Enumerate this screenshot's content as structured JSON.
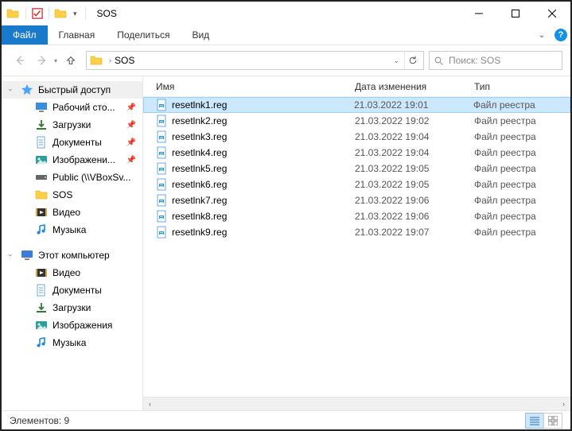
{
  "titlebar": {
    "title": "SOS"
  },
  "ribbon": {
    "file": "Файл",
    "home": "Главная",
    "share": "Поделиться",
    "view": "Вид"
  },
  "address": {
    "crumb": "SOS"
  },
  "search": {
    "placeholder": "Поиск: SOS"
  },
  "sidebar": {
    "quick_access": "Быстрый доступ",
    "items": [
      {
        "label": "Рабочий сто...",
        "icon": "desktop",
        "pinned": true
      },
      {
        "label": "Загрузки",
        "icon": "downloads",
        "pinned": true
      },
      {
        "label": "Документы",
        "icon": "documents",
        "pinned": true
      },
      {
        "label": "Изображени...",
        "icon": "pictures",
        "pinned": true
      },
      {
        "label": "Public (\\\\VBoxSv...",
        "icon": "drive",
        "pinned": false
      },
      {
        "label": "SOS",
        "icon": "folder",
        "pinned": false
      },
      {
        "label": "Видео",
        "icon": "videos",
        "pinned": false
      },
      {
        "label": "Музыка",
        "icon": "music",
        "pinned": false
      }
    ],
    "this_pc": "Этот компьютер",
    "pc_items": [
      {
        "label": "Видео",
        "icon": "videos"
      },
      {
        "label": "Документы",
        "icon": "documents"
      },
      {
        "label": "Загрузки",
        "icon": "downloads"
      },
      {
        "label": "Изображения",
        "icon": "pictures"
      },
      {
        "label": "Музыка",
        "icon": "music"
      }
    ]
  },
  "columns": {
    "name": "Имя",
    "date": "Дата изменения",
    "type": "Тип"
  },
  "files": [
    {
      "name": "resetlnk1.reg",
      "date": "21.03.2022 19:01",
      "type": "Файл реестра"
    },
    {
      "name": "resetlnk2.reg",
      "date": "21.03.2022 19:02",
      "type": "Файл реестра"
    },
    {
      "name": "resetlnk3.reg",
      "date": "21.03.2022 19:04",
      "type": "Файл реестра"
    },
    {
      "name": "resetlnk4.reg",
      "date": "21.03.2022 19:04",
      "type": "Файл реестра"
    },
    {
      "name": "resetlnk5.reg",
      "date": "21.03.2022 19:05",
      "type": "Файл реестра"
    },
    {
      "name": "resetlnk6.reg",
      "date": "21.03.2022 19:05",
      "type": "Файл реестра"
    },
    {
      "name": "resetlnk7.reg",
      "date": "21.03.2022 19:06",
      "type": "Файл реестра"
    },
    {
      "name": "resetlnk8.reg",
      "date": "21.03.2022 19:06",
      "type": "Файл реестра"
    },
    {
      "name": "resetlnk9.reg",
      "date": "21.03.2022 19:07",
      "type": "Файл реестра"
    }
  ],
  "status": {
    "count_label": "Элементов: 9"
  }
}
